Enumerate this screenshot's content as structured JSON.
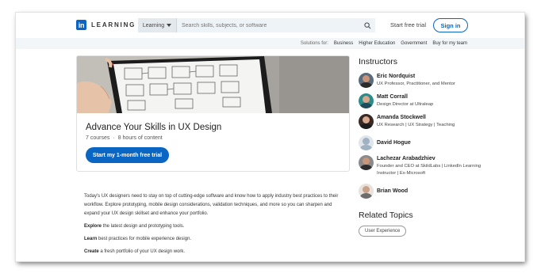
{
  "header": {
    "logo_text": "LEARNING",
    "logo_box": "in",
    "search_dropdown": "Learning",
    "search_placeholder": "Search skills, subjects, or software",
    "start_trial": "Start free trial",
    "sign_in": "Sign in"
  },
  "solutions": {
    "label": "Solutions for:",
    "items": [
      "Business",
      "Higher Education",
      "Government",
      "Buy for my team"
    ]
  },
  "course": {
    "title": "Advance Your Skills in UX Design",
    "courses": "7 courses",
    "separator": "·",
    "hours": "8 hours of content",
    "cta": "Start my 1-month free trial"
  },
  "description": {
    "intro": "Today's UX designers need to stay on top of cutting-edge software and know how to apply industry best practices to their workflow. Explore prototyping, mobile design considerations, validation techniques, and more so you can sharpen and expand your UX design skillset and enhance your portfolio.",
    "points": [
      {
        "bold": "Explore",
        "rest": " the latest design and prototyping tools."
      },
      {
        "bold": "Learn",
        "rest": " best practices for mobile experience design."
      },
      {
        "bold": "Create",
        "rest": " a fresh portfolio of your UX design work."
      }
    ]
  },
  "instructors": {
    "heading": "Instructors",
    "list": [
      {
        "name": "Eric Nordquist",
        "role": "UX Professor, Practitioner, and Mentor"
      },
      {
        "name": "Matt Corrall",
        "role": "Design Director at Ultraleap"
      },
      {
        "name": "Amanda Stockwell",
        "role": "UX Research | UX Strategy | Teaching"
      },
      {
        "name": "David Hogue",
        "role": ""
      },
      {
        "name": "Lachezar Arabadzhiev",
        "role": "Founder and CEO at SkildLabs | LinkedIn Learning Instructor | Ex-Microsoft"
      },
      {
        "name": "Brian Wood",
        "role": ""
      }
    ]
  },
  "related": {
    "heading": "Related Topics",
    "topics": [
      "User Experience"
    ]
  },
  "colors": {
    "brand": "#0a66c2",
    "bar": "#f3f6f8"
  }
}
